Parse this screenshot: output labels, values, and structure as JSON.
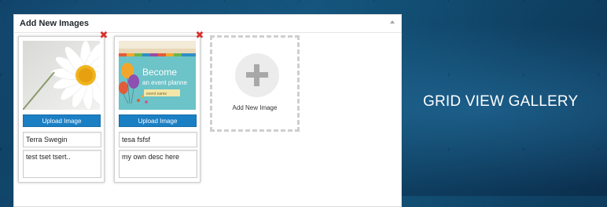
{
  "headline": "GRID VIEW GALLERY",
  "panel": {
    "title": "Add New Images",
    "toggle_icon": "triangle-up-icon"
  },
  "cards": [
    {
      "image": "daisy-photo",
      "upload_label": "Upload Image",
      "title_value": "Terra Swegin",
      "description_value": "test tset tsert..",
      "remove_icon": "close-x-icon"
    },
    {
      "image": "event-planner-banner",
      "image_text_line1": "Become",
      "image_text_line2": "an event planne",
      "image_badge": "event name",
      "upload_label": "Upload Image",
      "title_value": "tesa fsfsf",
      "description_value": "my own desc here",
      "remove_icon": "close-x-icon"
    }
  ],
  "add_new": {
    "label": "Add New Image",
    "icon": "plus-icon"
  },
  "colors": {
    "button_blue": "#1b7fc4",
    "remove_red": "#d9302b",
    "background_blue": "#125176"
  }
}
